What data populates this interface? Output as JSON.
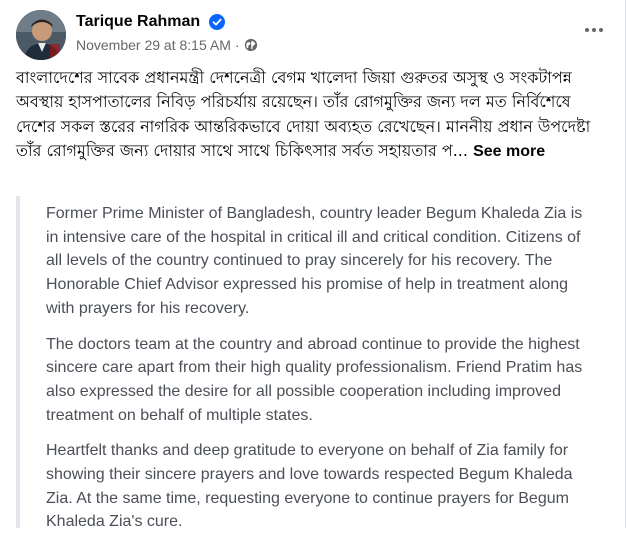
{
  "post": {
    "author": "Tarique Rahman",
    "timestamp": "November 29 at 8:15 AM",
    "separator": "·",
    "bangla_text": "বাংলাদেশের সাবেক প্রধানমন্ত্রী দেশনেত্রী বেগম খালেদা জিয়া গুরুতর অসুস্থ ও সংকটাপন্ন অবস্থায় হাসপাতালের নিবিড় পরিচর্যায় রয়েছেন। তাঁর রোগমুক্তির জন্য দল মত নির্বিশেষে দেশের সকল স্তরের নাগরিক আন্তরিকভাবে দোয়া অব্যহত রেখেছেন। মাননীয় প্রধান উপদেষ্টা তাঁর রোগমুক্তির জন্য দোয়ার সাথে সাথে চিকিৎসার সর্বত সহায়তার প...",
    "see_more": "See more",
    "translation": [
      "Former Prime Minister of Bangladesh, country leader Begum Khaleda Zia is in intensive care of the hospital in critical ill and critical condition. Citizens of all levels of the country continued to pray sincerely for his recovery. The Honorable Chief Advisor expressed his promise of help in treatment along with prayers for his recovery.",
      "The doctors team at the country and abroad continue to provide the highest sincere care apart from their high quality professionalism. Friend Pratim has also expressed the desire for all possible cooperation including improved treatment on behalf of multiple states.",
      "Heartfelt thanks and deep gratitude to everyone on behalf of Zia family for showing their sincere prayers and love towards respected Begum Khaleda Zia. At the same time, requesting everyone to continue prayers for Begum Khaleda Zia's cure."
    ]
  },
  "icons": {
    "verified": "verified-badge-icon",
    "audience": "globe-icon",
    "more": "more-options-icon"
  },
  "colors": {
    "verified_blue": "#0866ff",
    "meta_gray": "#65676b",
    "quote_border": "#e4e6eb",
    "quote_text": "#4b4f56"
  }
}
